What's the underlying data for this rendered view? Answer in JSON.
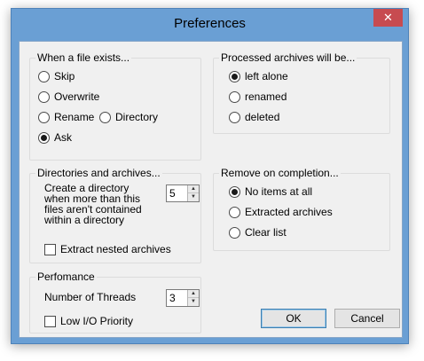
{
  "window": {
    "title": "Preferences",
    "close_glyph": "✕"
  },
  "file_exists": {
    "title": "When a file exists...",
    "options": [
      {
        "label": "Skip",
        "checked": false
      },
      {
        "label": "Overwrite",
        "checked": false
      },
      {
        "label": "Rename",
        "checked": false
      },
      {
        "label": "Directory",
        "checked": false
      },
      {
        "label": "Ask",
        "checked": true
      }
    ]
  },
  "processed": {
    "title": "Processed archives will be...",
    "options": [
      {
        "label": "left alone",
        "checked": true
      },
      {
        "label": "renamed",
        "checked": false
      },
      {
        "label": "deleted",
        "checked": false
      }
    ]
  },
  "directories": {
    "title": "Directories and archives...",
    "create_dir_label": "Create a directory when more than this files aren't contained within a directory",
    "create_dir_value": "5",
    "extract_nested_label": "Extract nested archives",
    "extract_nested_checked": false
  },
  "remove": {
    "title": "Remove on completion...",
    "options": [
      {
        "label": "No items at all",
        "checked": true
      },
      {
        "label": "Extracted archives",
        "checked": false
      },
      {
        "label": "Clear list",
        "checked": false
      }
    ]
  },
  "performance": {
    "title": "Perfomance",
    "threads_label": "Number of Threads",
    "threads_value": "3",
    "low_io_label": "Low I/O Priority",
    "low_io_checked": false
  },
  "buttons": {
    "ok": "OK",
    "cancel": "Cancel"
  },
  "icons": {
    "spin_up": "▲",
    "spin_down": "▼"
  }
}
